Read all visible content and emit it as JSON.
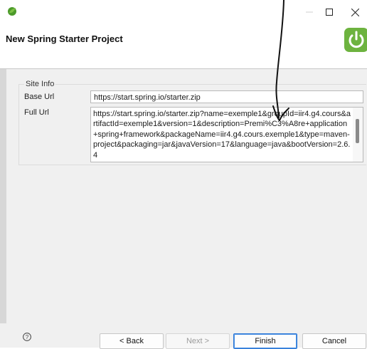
{
  "window": {
    "title_icon": "eclipse-spring-icon",
    "controls": [
      "minimize-icon",
      "maximize-icon",
      "close-icon"
    ]
  },
  "dialog": {
    "title": "New Spring Starter Project",
    "logo_icon": "spring-power-icon"
  },
  "site_info": {
    "group_label": "Site Info",
    "base_url_label": "Base Url",
    "base_url_value": "https://start.spring.io/starter.zip",
    "full_url_label": "Full Url",
    "full_url_value": "https://start.spring.io/starter.zip?name=exemple1&groupId=iir4.g4.cours&artifactId=exemple1&version=1&description=Premi%C3%A8re+application+spring+framework&packageName=iir4.g4.cours.exemple1&type=maven-project&packaging=jar&javaVersion=17&language=java&bootVersion=2.6.4"
  },
  "footer": {
    "help_icon": "help-icon",
    "back_label": "< Back",
    "next_label": "Next >",
    "finish_label": "Finish",
    "cancel_label": "Cancel"
  },
  "colors": {
    "accent_blue": "#2f79d8",
    "spring_green": "#6db33f",
    "eclipse_green": "#4c9a2a"
  }
}
